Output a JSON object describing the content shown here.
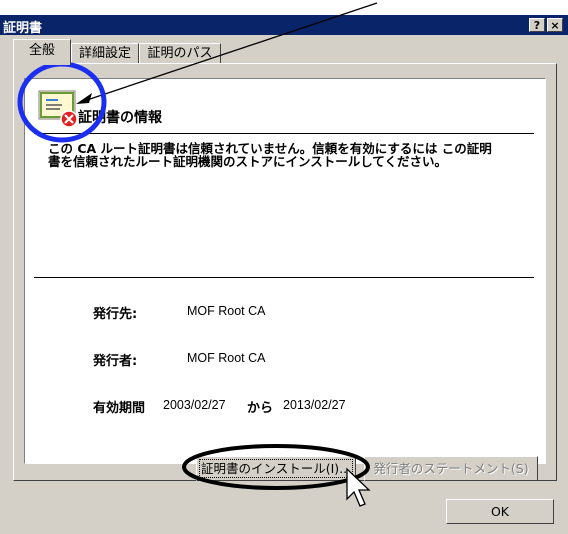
{
  "window": {
    "title": "証明書",
    "help_glyph": "?",
    "close_glyph": "×"
  },
  "tabs": [
    {
      "label": "全般"
    },
    {
      "label": "詳細設定"
    },
    {
      "label": "証明のパス"
    }
  ],
  "info": {
    "heading": "証明書の情報",
    "message": "この CA ルート証明書は信頼されていません。信頼を有効にするには この証明書を信頼されたルート証明機関のストアにインストールしてください。",
    "issued_to_label": "発行先:",
    "issued_to_value": "MOF Root CA",
    "issued_by_label": "発行者:",
    "issued_by_value": "MOF Root CA",
    "validity_label": "有効期間",
    "valid_from": "2003/02/27",
    "from_to_word": "から",
    "valid_to": "2013/02/27"
  },
  "buttons": {
    "install": "証明書のインストール(I)...",
    "issuer_statement": "発行者のステートメント(S)",
    "ok": "OK"
  },
  "colors": {
    "titlebar": "#0a246a",
    "dialog_bg": "#d4d0c8",
    "annotation": "#0000ff"
  }
}
